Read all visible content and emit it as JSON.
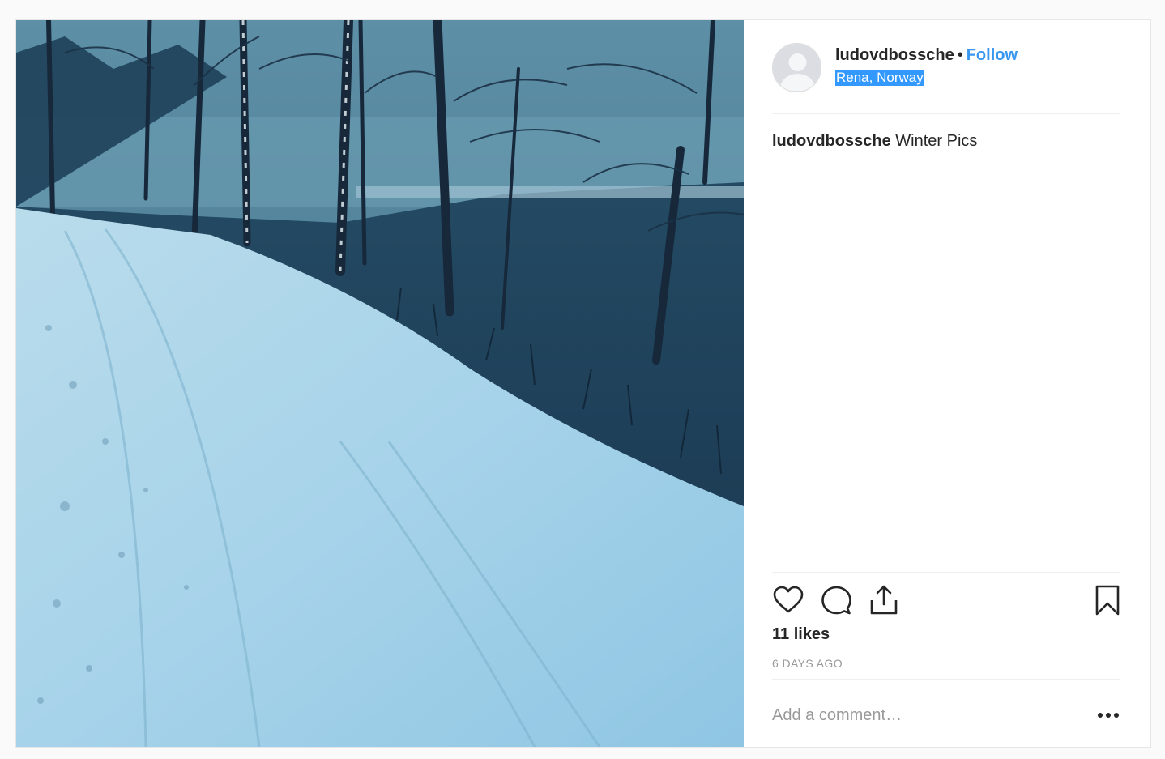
{
  "post": {
    "username": "ludovdbossche",
    "separator": "•",
    "follow_label": "Follow",
    "location": "Rena, Norway",
    "caption_user": "ludovdbossche",
    "caption_text": " Winter Pics",
    "likes": "11 likes",
    "time": "6 DAYS AGO",
    "comment_placeholder": "Add a comment…"
  },
  "icons": {
    "like": "heart-icon",
    "comment": "speech-bubble-icon",
    "share": "share-icon",
    "save": "bookmark-icon",
    "more": "more-options-icon",
    "avatar": "default-avatar-icon"
  },
  "colors": {
    "link": "#3897f0",
    "selection": "#3399ff",
    "muted": "#999999",
    "text": "#262626"
  }
}
